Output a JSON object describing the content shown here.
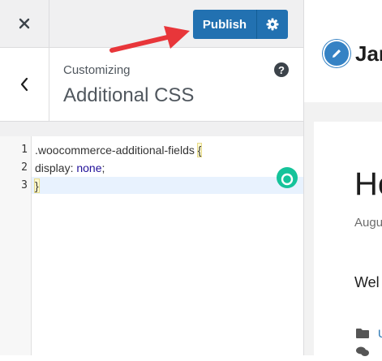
{
  "toolbar": {
    "publish_label": "Publish"
  },
  "section": {
    "breadcrumb": "Customizing",
    "title": "Additional CSS",
    "help_label": "?"
  },
  "editor": {
    "line_numbers": [
      "1",
      "2",
      "3"
    ],
    "line1_selector": ".woocommerce-additional-fields ",
    "line1_brace": "{",
    "line2_property": "display: ",
    "line2_value": "none",
    "line2_semicolon": ";",
    "line3_brace": "}"
  },
  "preview": {
    "site_name": "Jar",
    "post_heading": "He",
    "post_date": "Augu",
    "post_excerpt": "Wel",
    "category_link": "U"
  },
  "colors": {
    "accent": "#2271b1",
    "grammarly": "#15c39a",
    "active_line": "#e8f2fe"
  },
  "icons": [
    "close-icon",
    "gear-icon",
    "chevron-left-icon",
    "help-icon",
    "pencil-icon",
    "folder-icon",
    "comments-icon",
    "grammarly-icon",
    "red-arrow"
  ]
}
